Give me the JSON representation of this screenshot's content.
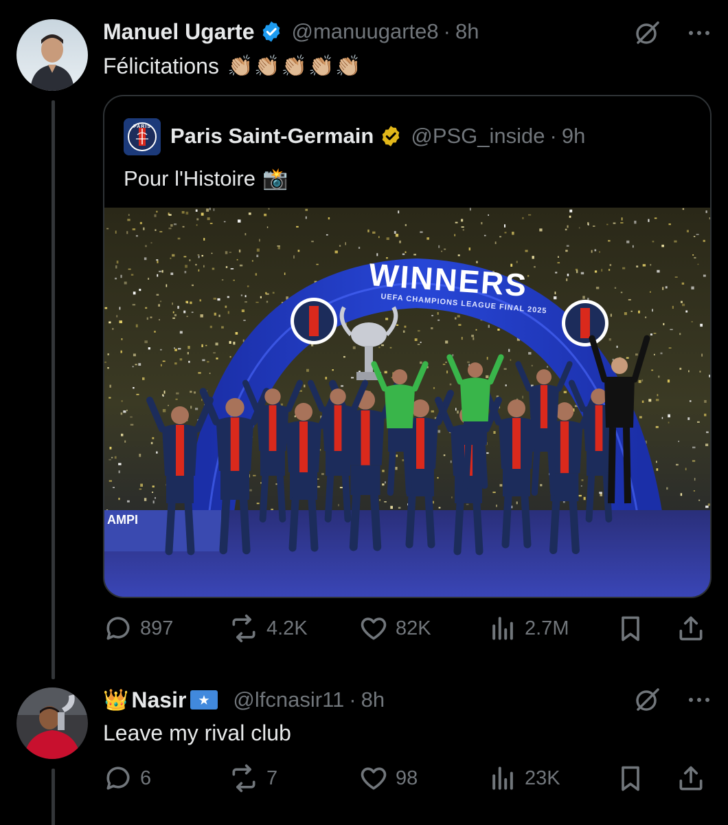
{
  "tweet": {
    "author_name": "Manuel Ugarte",
    "handle": "@manuugarte8",
    "separator": "·",
    "time": "8h",
    "verified_color": "#1d9bf0",
    "text": "Félicitations",
    "emoji": "👏🏼👏🏼👏🏼👏🏼👏🏼",
    "quoted": {
      "author_name": "Paris Saint-Germain",
      "handle": "@PSG_inside",
      "separator": "·",
      "time": "9h",
      "verified_color": "#e2b719",
      "text": "Pour l'Histoire",
      "emoji": "📸",
      "logo_text": "PARIS",
      "image": {
        "banner_text": "WINNERS",
        "banner_subtext": "UEFA CHAMPIONS LEAGUE FINAL 2025"
      }
    },
    "actions": {
      "replies": "897",
      "reposts": "4.2K",
      "likes": "82K",
      "views": "2.7M"
    }
  },
  "reply": {
    "author_prefix_emoji": "👑",
    "author_name": "Nasir",
    "author_suffix_emoji": "🇸🇴",
    "handle": "@lfcnasir11",
    "separator": "·",
    "time": "8h",
    "text": "Leave my rival club",
    "actions": {
      "replies": "6",
      "reposts": "7",
      "likes": "98",
      "views": "23K"
    }
  },
  "colors": {
    "background": "#000000",
    "text_primary": "#e7e9ea",
    "text_secondary": "#71767b",
    "border": "#2f3336",
    "psg_navy": "#1c2c5b",
    "psg_red": "#da291c"
  }
}
